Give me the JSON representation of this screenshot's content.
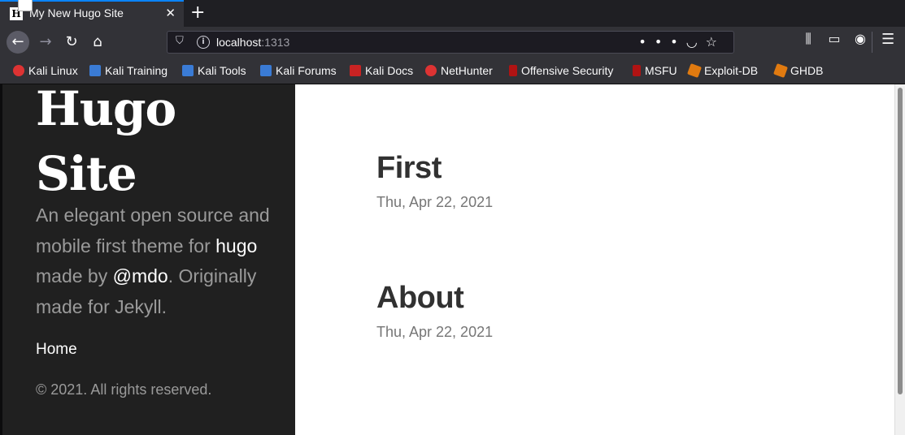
{
  "browser": {
    "tab": {
      "title": "My New Hugo Site",
      "favicon": "H",
      "close": "✕"
    },
    "new_tab": "+",
    "url": {
      "host": "localhost",
      "port": ":1313"
    },
    "bookmarks": [
      {
        "label": "Kali Linux",
        "icon": "kali-icon"
      },
      {
        "label": "Kali Training",
        "icon": "kali-tool-icon"
      },
      {
        "label": "Kali Tools",
        "icon": "kali-tool-icon"
      },
      {
        "label": "Kali Forums",
        "icon": "kali-tool-icon"
      },
      {
        "label": "Kali Docs",
        "icon": "docs-icon"
      },
      {
        "label": "NetHunter",
        "icon": "kali-icon"
      },
      {
        "label": "Offensive Security",
        "icon": "offsec-icon"
      },
      {
        "label": "MSFU",
        "icon": "offsec-icon"
      },
      {
        "label": "Exploit-DB",
        "icon": "exploit-icon"
      },
      {
        "label": "GHDB",
        "icon": "exploit-icon"
      }
    ]
  },
  "sidebar": {
    "title_line1": "Hugo",
    "title_line2": "Site",
    "lead_part1": "An elegant open source and mobile first theme for ",
    "lead_link1": "hugo",
    "lead_part2": " made by ",
    "lead_link2": "@mdo",
    "lead_part3": ". Originally made for Jekyll.",
    "nav_home": "Home",
    "copyright": "© 2021. All rights reserved."
  },
  "posts": [
    {
      "title": "First",
      "date": "Thu, Apr 22, 2021"
    },
    {
      "title": "About",
      "date": "Thu, Apr 22, 2021"
    }
  ],
  "colors": {
    "accent": "#0a84ff",
    "sidebar_bg": "#202020",
    "content_bg": "#ffffff"
  }
}
